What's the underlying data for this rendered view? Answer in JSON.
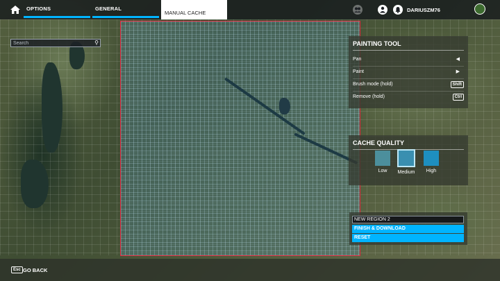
{
  "topbar": {
    "tabs": [
      {
        "label": "OPTIONS"
      },
      {
        "label": "GENERAL"
      }
    ],
    "active_tab": "MANUAL CACHE",
    "username": "DARIUSZM76",
    "icons": [
      "home-icon",
      "friends-icon",
      "profile-icon",
      "notifications-icon",
      "avatar"
    ]
  },
  "search": {
    "placeholder": "Search",
    "value": ""
  },
  "painting_tool": {
    "title": "PAINTING TOOL",
    "rows": [
      {
        "label": "Pan",
        "key": ""
      },
      {
        "label": "Paint",
        "key": ""
      },
      {
        "label": "Brush mode (hold)",
        "key": "Shift"
      },
      {
        "label": "Remove (hold)",
        "key": "Ctrl"
      }
    ]
  },
  "cache_quality": {
    "title": "CACHE QUALITY",
    "options": [
      {
        "label": "Low"
      },
      {
        "label": "Medium"
      },
      {
        "label": "High"
      }
    ],
    "selected": "Medium"
  },
  "region": {
    "name_value": "NEW REGION 2",
    "finish_label": "FINISH & DOWNLOAD",
    "reset_label": "RESET"
  },
  "footer": {
    "key": "Esc",
    "back_label": "GO BACK"
  },
  "colors": {
    "accent": "#00b4ff",
    "selection_border": "#e0253a"
  }
}
